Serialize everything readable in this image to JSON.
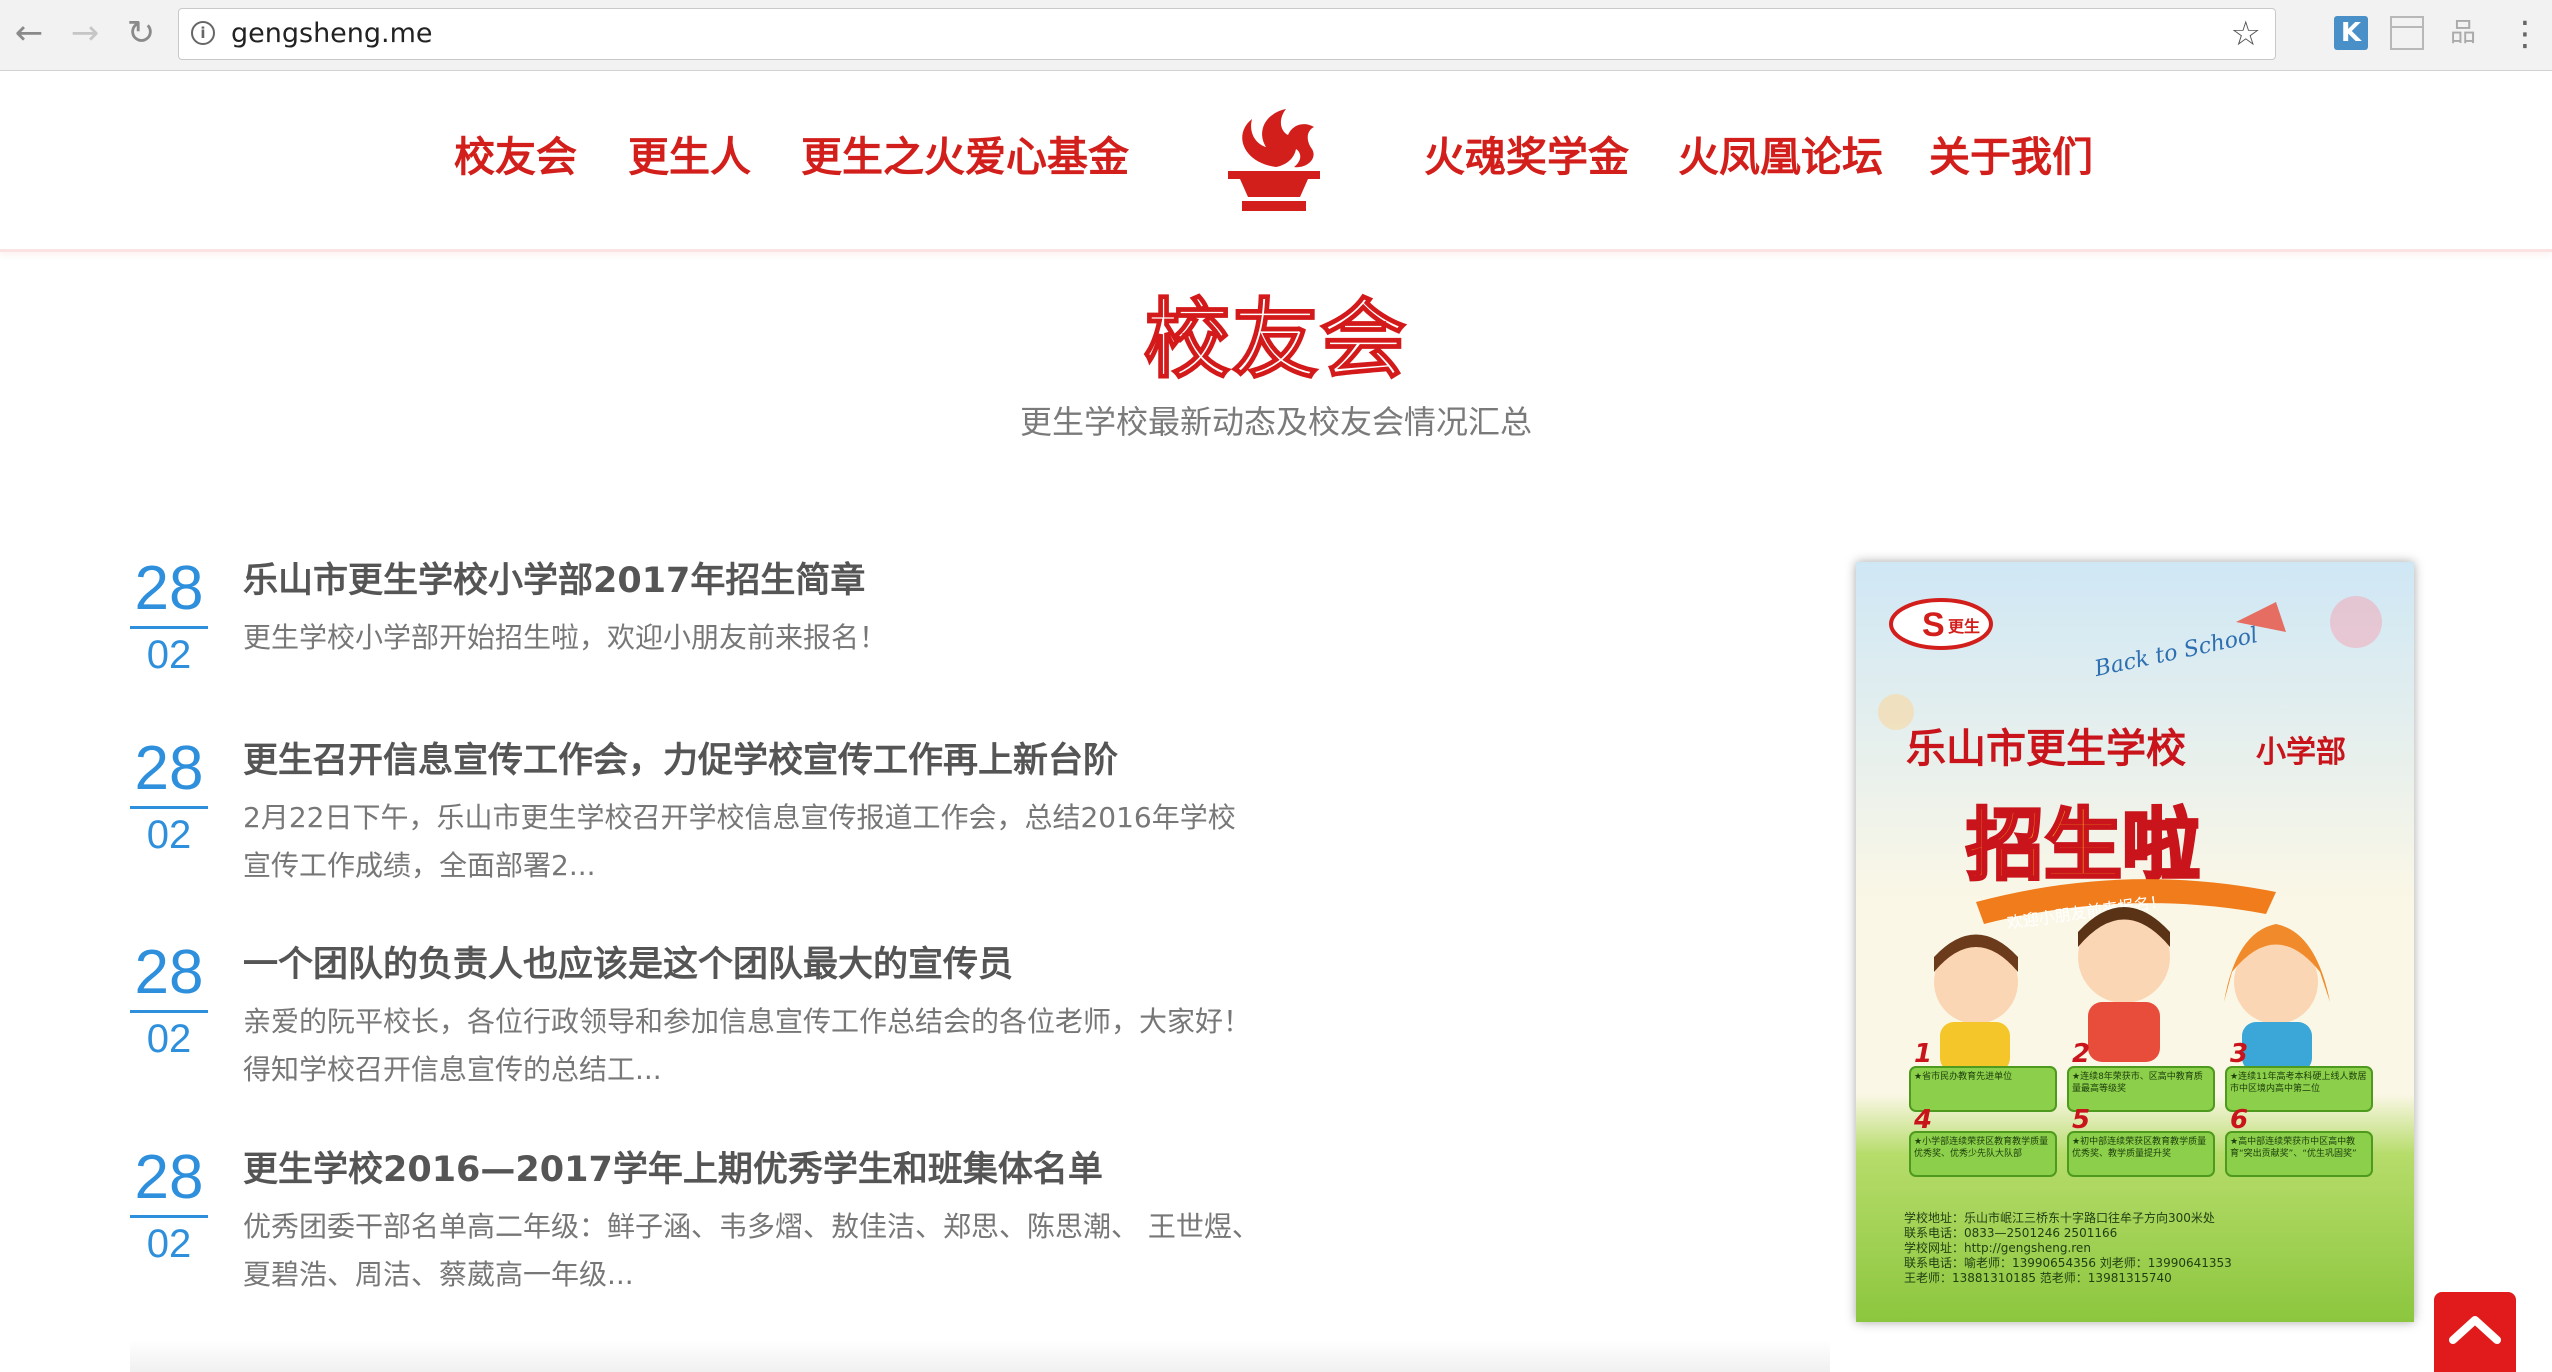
{
  "browser": {
    "url": "gengsheng.me",
    "back_icon": "←",
    "forward_icon": "→",
    "reload_icon": "↻",
    "info_icon": "i",
    "star_icon": "☆",
    "ext_k_label": "K",
    "tree_icon": "品",
    "menu_icon": "⋮"
  },
  "nav": {
    "left": [
      "校友会",
      "更生人",
      "更生之火爱心基金"
    ],
    "right": [
      "火魂奖学金",
      "火凤凰论坛",
      "关于我们"
    ]
  },
  "section": {
    "title": "校友会",
    "subtitle": "更生学校最新动态及校友会情况汇总"
  },
  "news": [
    {
      "day": "28",
      "month": "02",
      "title": "乐山市更生学校小学部2017年招生简章",
      "desc": "更生学校小学部开始招生啦，欢迎小朋友前来报名！"
    },
    {
      "day": "28",
      "month": "02",
      "title": "更生召开信息宣传工作会，力促学校宣传工作再上新台阶",
      "desc": "2月22日下午，乐山市更生学校召开学校信息宣传报道工作会，总结2016年学校宣传工作成绩，全面部署2..."
    },
    {
      "day": "28",
      "month": "02",
      "title": "一个团队的负责人也应该是这个团队最大的宣传员",
      "desc": "亲爱的阮平校长，各位行政领导和参加信息宣传工作总结会的各位老师，大家好！得知学校召开信息宣传的总结工..."
    },
    {
      "day": "28",
      "month": "02",
      "title": "更生学校2016—2017学年上期优秀学生和班集体名单",
      "desc": "优秀团委干部名单高二年级：鲜子涵、韦多熠、敖佳洁、郑思、陈思潮、 王世煜、夏碧浩、周洁、蔡葳高一年级..."
    }
  ],
  "poster": {
    "logo_text": "更生",
    "back_to_school": "Back to School",
    "school_name": "乐山市更生学校",
    "dept": "小学部",
    "headline": "招生啦",
    "ribbon": "欢迎小朋友前来报名！",
    "features": [
      {
        "num": "1",
        "text": "★省市民办教育先进单位"
      },
      {
        "num": "2",
        "text": "★连续8年荣获市、区高中教育质量最高等级奖"
      },
      {
        "num": "3",
        "text": "★连续11年高考本科硬上线人数居市中区境内高中第二位"
      },
      {
        "num": "4",
        "text": "★小学部连续荣获区教育教学质量优秀奖、优秀少先队大队部"
      },
      {
        "num": "5",
        "text": "★初中部连续荣获区教育教学质量优秀奖、教学质量提升奖"
      },
      {
        "num": "6",
        "text": "★高中部连续荣获市中区高中教育“突出贡献奖”、“优生巩固奖”"
      }
    ],
    "contact": [
      "学校地址：乐山市岷江三桥东十字路口往牟子方向300米处",
      "联系电话：0833—2501246  2501166",
      "学校网址：http://gengsheng.ren",
      "联系电话：喻老师：13990654356    刘老师：13990641353",
      "王老师：13881310185    范老师：13981315740"
    ]
  },
  "colors": {
    "brand_red": "#d21f1b",
    "date_blue": "#2e8fdc",
    "poster_green": "#7cc52a"
  },
  "back_to_top_icon": "chevron-up-icon"
}
